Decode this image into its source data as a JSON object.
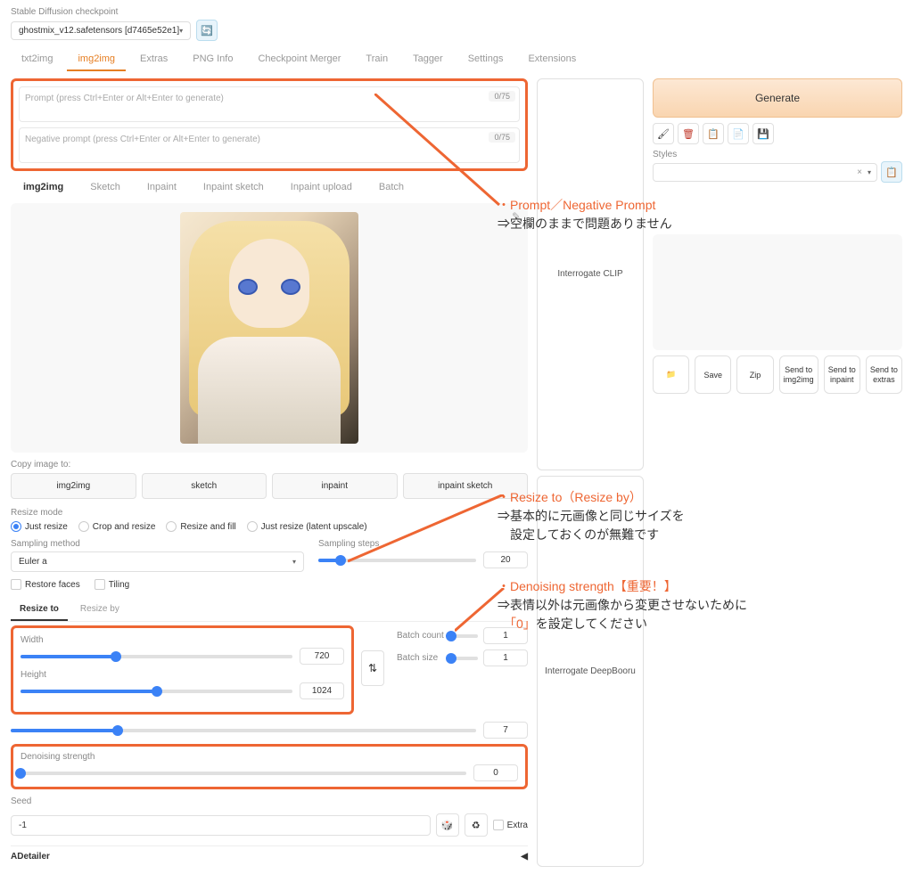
{
  "checkpoint": {
    "label": "Stable Diffusion checkpoint",
    "value": "ghostmix_v12.safetensors [d7465e52e1]"
  },
  "main_tabs": [
    "txt2img",
    "img2img",
    "Extras",
    "PNG Info",
    "Checkpoint Merger",
    "Train",
    "Tagger",
    "Settings",
    "Extensions"
  ],
  "active_main_tab": 1,
  "prompt": {
    "placeholder": "Prompt (press Ctrl+Enter or Alt+Enter to generate)",
    "neg_placeholder": "Negative prompt (press Ctrl+Enter or Alt+Enter to generate)",
    "tokens": "0/75",
    "neg_tokens": "0/75"
  },
  "interrogate": {
    "clip": "Interrogate CLIP",
    "deep": "Interrogate DeepBooru"
  },
  "generate": "Generate",
  "styles_label": "Styles",
  "styles_clear": "×",
  "sub_tabs": [
    "img2img",
    "Sketch",
    "Inpaint",
    "Inpaint sketch",
    "Inpaint upload",
    "Batch"
  ],
  "active_sub_tab": 0,
  "copy_label": "Copy image to:",
  "copy_btns": [
    "img2img",
    "sketch",
    "inpaint",
    "inpaint sketch"
  ],
  "resize_mode_label": "Resize mode",
  "resize_modes": [
    "Just resize",
    "Crop and resize",
    "Resize and fill",
    "Just resize (latent upscale)"
  ],
  "sampling_method_label": "Sampling method",
  "sampling_method": "Euler a",
  "sampling_steps_label": "Sampling steps",
  "sampling_steps": "20",
  "restore_faces": "Restore faces",
  "tiling": "Tiling",
  "resize_tabs": [
    "Resize to",
    "Resize by"
  ],
  "width_label": "Width",
  "width": "720",
  "height_label": "Height",
  "height": "1024",
  "batch_count_label": "Batch count",
  "batch_count": "1",
  "batch_size_label": "Batch size",
  "batch_size": "1",
  "cfg_value": "7",
  "denoise_label": "Denoising strength",
  "denoise": "0",
  "seed_label": "Seed",
  "seed": "-1",
  "extra_label": "Extra",
  "adetailer": "ADetailer",
  "output_btns": [
    "📁",
    "Save",
    "Zip",
    "Send to img2img",
    "Send to inpaint",
    "Send to extras"
  ],
  "icons": {
    "paint": "🖌",
    "trash": "🗑",
    "clip": "📋",
    "doc": "📄",
    "save": "💾"
  },
  "ann1": {
    "t1": "・Prompt／Negative Prompt",
    "t2": "⇒空欄のままで問題ありません"
  },
  "ann2": {
    "t1": "・Resize to（Resize by）",
    "t2": "⇒基本的に元画像と同じサイズを",
    "t3": "　設定しておくのが無難です"
  },
  "ann3": {
    "t1": "・Denoising strength【重要！】",
    "t2": "⇒表情以外は元画像から変更させないために",
    "t3a": "　",
    "t3b": "「0」",
    "t3c": "を設定してください"
  }
}
